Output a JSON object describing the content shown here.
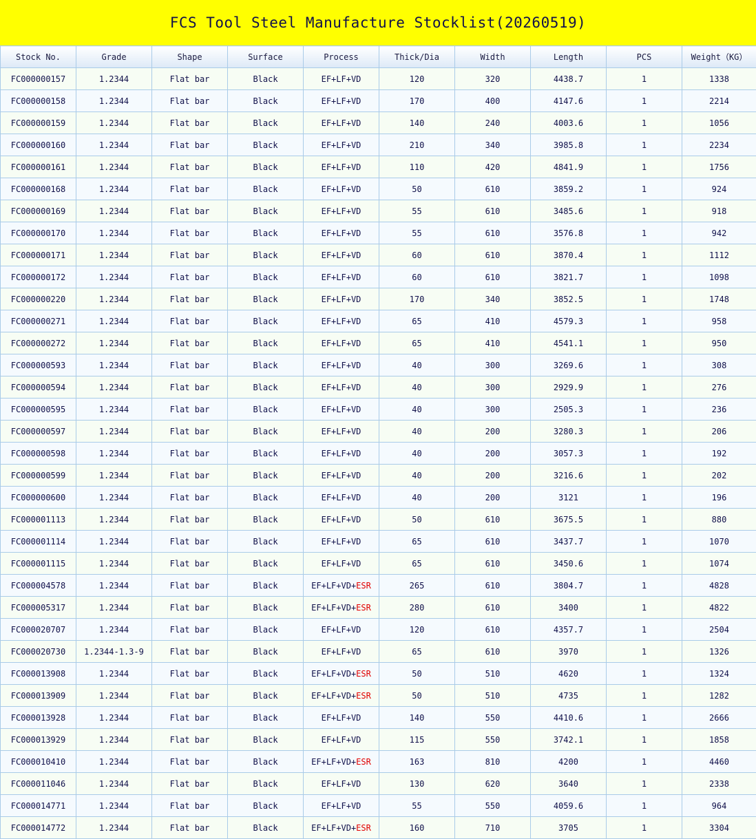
{
  "title": "FCS Tool Steel Manufacture Stocklist(20260519)",
  "columns": [
    "Stock No.",
    "Grade",
    "Shape",
    "Surface",
    "Process",
    "Thick/Dia",
    "Width",
    "Length",
    "PCS",
    "Weight（KG）"
  ],
  "colors": {
    "title_background": "#ffff00",
    "esr_highlight": "#e00000",
    "grid_border": "#a9cbe8"
  },
  "rows": [
    {
      "stock_no": "FC000000157",
      "grade": "1.2344",
      "shape": "Flat bar",
      "surface": "Black",
      "process": "EF+LF+VD",
      "process_extra": "",
      "thick": "120",
      "width": "320",
      "length": "4438.7",
      "pcs": "1",
      "weight": "1338"
    },
    {
      "stock_no": "FC000000158",
      "grade": "1.2344",
      "shape": "Flat bar",
      "surface": "Black",
      "process": "EF+LF+VD",
      "process_extra": "",
      "thick": "170",
      "width": "400",
      "length": "4147.6",
      "pcs": "1",
      "weight": "2214"
    },
    {
      "stock_no": "FC000000159",
      "grade": "1.2344",
      "shape": "Flat bar",
      "surface": "Black",
      "process": "EF+LF+VD",
      "process_extra": "",
      "thick": "140",
      "width": "240",
      "length": "4003.6",
      "pcs": "1",
      "weight": "1056"
    },
    {
      "stock_no": "FC000000160",
      "grade": "1.2344",
      "shape": "Flat bar",
      "surface": "Black",
      "process": "EF+LF+VD",
      "process_extra": "",
      "thick": "210",
      "width": "340",
      "length": "3985.8",
      "pcs": "1",
      "weight": "2234"
    },
    {
      "stock_no": "FC000000161",
      "grade": "1.2344",
      "shape": "Flat bar",
      "surface": "Black",
      "process": "EF+LF+VD",
      "process_extra": "",
      "thick": "110",
      "width": "420",
      "length": "4841.9",
      "pcs": "1",
      "weight": "1756"
    },
    {
      "stock_no": "FC000000168",
      "grade": "1.2344",
      "shape": "Flat bar",
      "surface": "Black",
      "process": "EF+LF+VD",
      "process_extra": "",
      "thick": "50",
      "width": "610",
      "length": "3859.2",
      "pcs": "1",
      "weight": "924"
    },
    {
      "stock_no": "FC000000169",
      "grade": "1.2344",
      "shape": "Flat bar",
      "surface": "Black",
      "process": "EF+LF+VD",
      "process_extra": "",
      "thick": "55",
      "width": "610",
      "length": "3485.6",
      "pcs": "1",
      "weight": "918"
    },
    {
      "stock_no": "FC000000170",
      "grade": "1.2344",
      "shape": "Flat bar",
      "surface": "Black",
      "process": "EF+LF+VD",
      "process_extra": "",
      "thick": "55",
      "width": "610",
      "length": "3576.8",
      "pcs": "1",
      "weight": "942"
    },
    {
      "stock_no": "FC000000171",
      "grade": "1.2344",
      "shape": "Flat bar",
      "surface": "Black",
      "process": "EF+LF+VD",
      "process_extra": "",
      "thick": "60",
      "width": "610",
      "length": "3870.4",
      "pcs": "1",
      "weight": "1112"
    },
    {
      "stock_no": "FC000000172",
      "grade": "1.2344",
      "shape": "Flat bar",
      "surface": "Black",
      "process": "EF+LF+VD",
      "process_extra": "",
      "thick": "60",
      "width": "610",
      "length": "3821.7",
      "pcs": "1",
      "weight": "1098"
    },
    {
      "stock_no": "FC000000220",
      "grade": "1.2344",
      "shape": "Flat bar",
      "surface": "Black",
      "process": "EF+LF+VD",
      "process_extra": "",
      "thick": "170",
      "width": "340",
      "length": "3852.5",
      "pcs": "1",
      "weight": "1748"
    },
    {
      "stock_no": "FC000000271",
      "grade": "1.2344",
      "shape": "Flat bar",
      "surface": "Black",
      "process": "EF+LF+VD",
      "process_extra": "",
      "thick": "65",
      "width": "410",
      "length": "4579.3",
      "pcs": "1",
      "weight": "958"
    },
    {
      "stock_no": "FC000000272",
      "grade": "1.2344",
      "shape": "Flat bar",
      "surface": "Black",
      "process": "EF+LF+VD",
      "process_extra": "",
      "thick": "65",
      "width": "410",
      "length": "4541.1",
      "pcs": "1",
      "weight": "950"
    },
    {
      "stock_no": "FC000000593",
      "grade": "1.2344",
      "shape": "Flat bar",
      "surface": "Black",
      "process": "EF+LF+VD",
      "process_extra": "",
      "thick": "40",
      "width": "300",
      "length": "3269.6",
      "pcs": "1",
      "weight": "308"
    },
    {
      "stock_no": "FC000000594",
      "grade": "1.2344",
      "shape": "Flat bar",
      "surface": "Black",
      "process": "EF+LF+VD",
      "process_extra": "",
      "thick": "40",
      "width": "300",
      "length": "2929.9",
      "pcs": "1",
      "weight": "276"
    },
    {
      "stock_no": "FC000000595",
      "grade": "1.2344",
      "shape": "Flat bar",
      "surface": "Black",
      "process": "EF+LF+VD",
      "process_extra": "",
      "thick": "40",
      "width": "300",
      "length": "2505.3",
      "pcs": "1",
      "weight": "236"
    },
    {
      "stock_no": "FC000000597",
      "grade": "1.2344",
      "shape": "Flat bar",
      "surface": "Black",
      "process": "EF+LF+VD",
      "process_extra": "",
      "thick": "40",
      "width": "200",
      "length": "3280.3",
      "pcs": "1",
      "weight": "206"
    },
    {
      "stock_no": "FC000000598",
      "grade": "1.2344",
      "shape": "Flat bar",
      "surface": "Black",
      "process": "EF+LF+VD",
      "process_extra": "",
      "thick": "40",
      "width": "200",
      "length": "3057.3",
      "pcs": "1",
      "weight": "192"
    },
    {
      "stock_no": "FC000000599",
      "grade": "1.2344",
      "shape": "Flat bar",
      "surface": "Black",
      "process": "EF+LF+VD",
      "process_extra": "",
      "thick": "40",
      "width": "200",
      "length": "3216.6",
      "pcs": "1",
      "weight": "202"
    },
    {
      "stock_no": "FC000000600",
      "grade": "1.2344",
      "shape": "Flat bar",
      "surface": "Black",
      "process": "EF+LF+VD",
      "process_extra": "",
      "thick": "40",
      "width": "200",
      "length": "3121",
      "pcs": "1",
      "weight": "196"
    },
    {
      "stock_no": "FC000001113",
      "grade": "1.2344",
      "shape": "Flat bar",
      "surface": "Black",
      "process": "EF+LF+VD",
      "process_extra": "",
      "thick": "50",
      "width": "610",
      "length": "3675.5",
      "pcs": "1",
      "weight": "880"
    },
    {
      "stock_no": "FC000001114",
      "grade": "1.2344",
      "shape": "Flat bar",
      "surface": "Black",
      "process": "EF+LF+VD",
      "process_extra": "",
      "thick": "65",
      "width": "610",
      "length": "3437.7",
      "pcs": "1",
      "weight": "1070"
    },
    {
      "stock_no": "FC000001115",
      "grade": "1.2344",
      "shape": "Flat bar",
      "surface": "Black",
      "process": "EF+LF+VD",
      "process_extra": "",
      "thick": "65",
      "width": "610",
      "length": "3450.6",
      "pcs": "1",
      "weight": "1074"
    },
    {
      "stock_no": "FC000004578",
      "grade": "1.2344",
      "shape": "Flat bar",
      "surface": "Black",
      "process": "EF+LF+VD+",
      "process_extra": "ESR",
      "thick": "265",
      "width": "610",
      "length": "3804.7",
      "pcs": "1",
      "weight": "4828"
    },
    {
      "stock_no": "FC000005317",
      "grade": "1.2344",
      "shape": "Flat bar",
      "surface": "Black",
      "process": "EF+LF+VD+",
      "process_extra": "ESR",
      "thick": "280",
      "width": "610",
      "length": "3400",
      "pcs": "1",
      "weight": "4822"
    },
    {
      "stock_no": "FC000020707",
      "grade": "1.2344",
      "shape": "Flat bar",
      "surface": "Black",
      "process": "EF+LF+VD",
      "process_extra": "",
      "thick": "120",
      "width": "610",
      "length": "4357.7",
      "pcs": "1",
      "weight": "2504"
    },
    {
      "stock_no": "FC000020730",
      "grade": "1.2344-1.3-9",
      "shape": "Flat bar",
      "surface": "Black",
      "process": "EF+LF+VD",
      "process_extra": "",
      "thick": "65",
      "width": "610",
      "length": "3970",
      "pcs": "1",
      "weight": "1326"
    },
    {
      "stock_no": "FC000013908",
      "grade": "1.2344",
      "shape": "Flat bar",
      "surface": "Black",
      "process": "EF+LF+VD+",
      "process_extra": "ESR",
      "thick": "50",
      "width": "510",
      "length": "4620",
      "pcs": "1",
      "weight": "1324"
    },
    {
      "stock_no": "FC000013909",
      "grade": "1.2344",
      "shape": "Flat bar",
      "surface": "Black",
      "process": "EF+LF+VD+",
      "process_extra": "ESR",
      "thick": "50",
      "width": "510",
      "length": "4735",
      "pcs": "1",
      "weight": "1282"
    },
    {
      "stock_no": "FC000013928",
      "grade": "1.2344",
      "shape": "Flat bar",
      "surface": "Black",
      "process": "EF+LF+VD",
      "process_extra": "",
      "thick": "140",
      "width": "550",
      "length": "4410.6",
      "pcs": "1",
      "weight": "2666"
    },
    {
      "stock_no": "FC000013929",
      "grade": "1.2344",
      "shape": "Flat bar",
      "surface": "Black",
      "process": "EF+LF+VD",
      "process_extra": "",
      "thick": "115",
      "width": "550",
      "length": "3742.1",
      "pcs": "1",
      "weight": "1858"
    },
    {
      "stock_no": "FC000010410",
      "grade": "1.2344",
      "shape": "Flat bar",
      "surface": "Black",
      "process": "EF+LF+VD+",
      "process_extra": "ESR",
      "thick": "163",
      "width": "810",
      "length": "4200",
      "pcs": "1",
      "weight": "4460"
    },
    {
      "stock_no": "FC000011046",
      "grade": "1.2344",
      "shape": "Flat bar",
      "surface": "Black",
      "process": "EF+LF+VD",
      "process_extra": "",
      "thick": "130",
      "width": "620",
      "length": "3640",
      "pcs": "1",
      "weight": "2338"
    },
    {
      "stock_no": "FC000014771",
      "grade": "1.2344",
      "shape": "Flat bar",
      "surface": "Black",
      "process": "EF+LF+VD",
      "process_extra": "",
      "thick": "55",
      "width": "550",
      "length": "4059.6",
      "pcs": "1",
      "weight": "964"
    },
    {
      "stock_no": "FC000014772",
      "grade": "1.2344",
      "shape": "Flat bar",
      "surface": "Black",
      "process": "EF+LF+VD+",
      "process_extra": "ESR",
      "thick": "160",
      "width": "710",
      "length": "3705",
      "pcs": "1",
      "weight": "3304"
    }
  ]
}
